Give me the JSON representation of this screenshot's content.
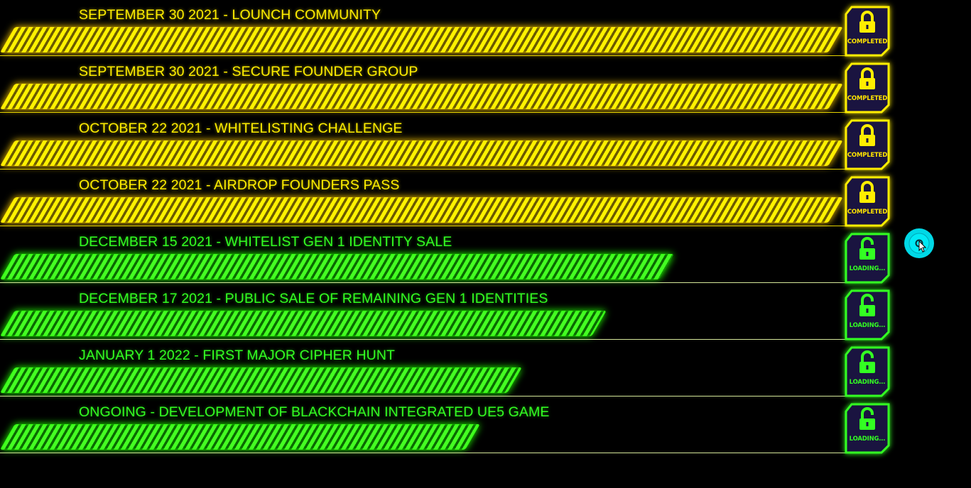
{
  "colors": {
    "completed": "#ffee00",
    "loading": "#33ff22",
    "background": "#000000",
    "badge_fill": "#1a1440",
    "cursor_ring": "#00e5f0"
  },
  "milestones": [
    {
      "label": "SEPTEMBER 30 2021 - LOUNCH COMMUNITY",
      "status": "COMPLETED",
      "state": "completed",
      "progress": 1.0,
      "icon": "lock-icon"
    },
    {
      "label": "SEPTEMBER 30 2021 - SECURE FOUNDER GROUP",
      "status": "COMPLETED",
      "state": "completed",
      "progress": 1.0,
      "icon": "lock-icon"
    },
    {
      "label": "OCTOBER 22 2021 - WHITELISTING CHALLENGE",
      "status": "COMPLETED",
      "state": "completed",
      "progress": 1.0,
      "icon": "lock-icon"
    },
    {
      "label": "OCTOBER 22 2021 - AIRDROP FOUNDERS PASS",
      "status": "COMPLETED",
      "state": "completed",
      "progress": 1.0,
      "icon": "lock-icon"
    },
    {
      "label": "DECEMBER 15 2021 - WHITELIST GEN 1 IDENTITY SALE",
      "status": "LOADING...",
      "state": "loading",
      "progress": 0.78,
      "icon": "unlock-icon"
    },
    {
      "label": "DECEMBER 17 2021 - PUBLIC SALE OF REMAINING GEN 1 IDENTITIES",
      "status": "LOADING...",
      "state": "loading",
      "progress": 0.7,
      "icon": "unlock-icon"
    },
    {
      "label": "JANUARY 1 2022 - FIRST MAJOR CIPHER HUNT",
      "status": "LOADING...",
      "state": "loading",
      "progress": 0.6,
      "icon": "unlock-icon"
    },
    {
      "label": "ONGOING - DEVELOPMENT OF BLACKCHAIN INTEGRATED UE5 GAME",
      "status": "LOADING...",
      "state": "loading",
      "progress": 0.55,
      "icon": "unlock-icon"
    }
  ]
}
